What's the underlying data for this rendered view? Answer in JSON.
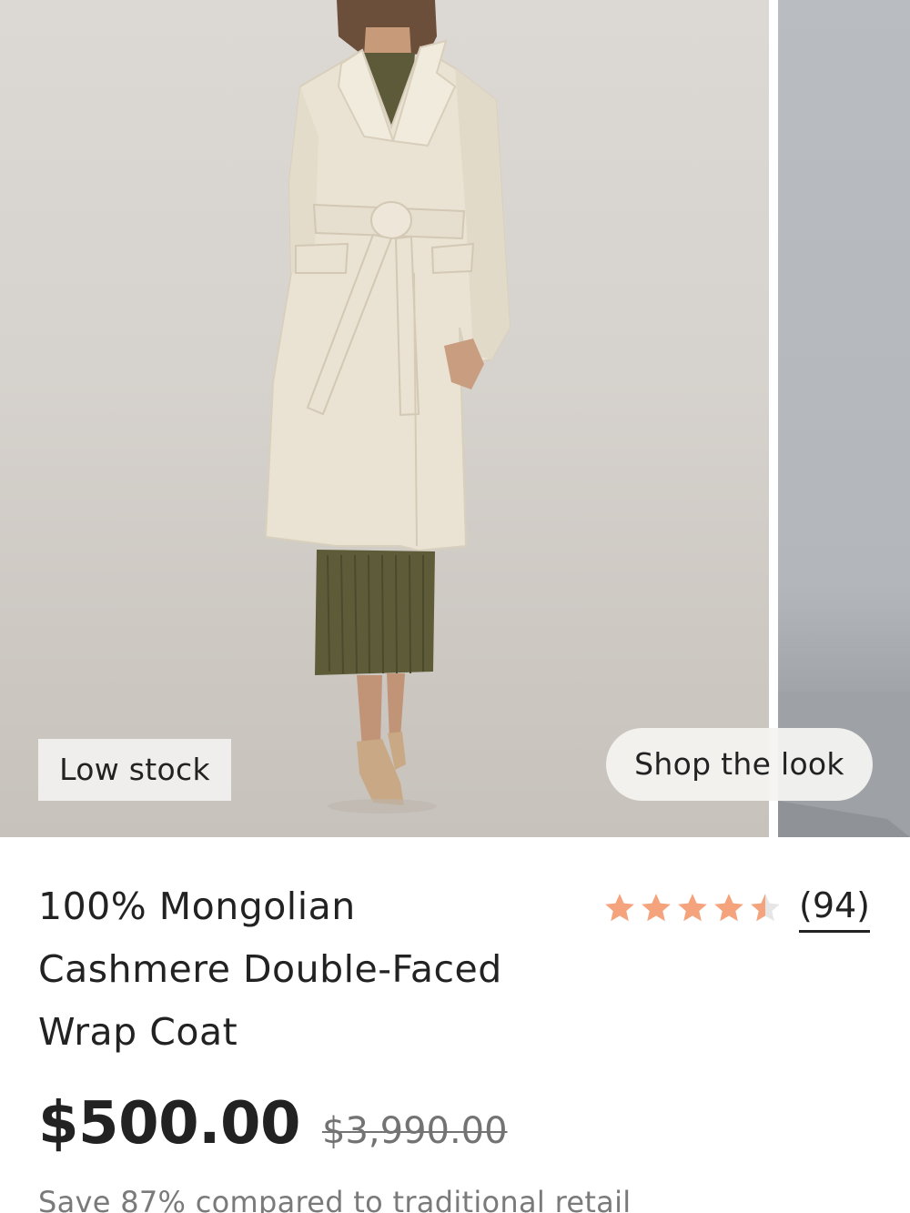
{
  "gallery": {
    "main_image_alt": "",
    "badge": "Low stock",
    "shop_the_look": "Shop the look"
  },
  "product": {
    "title_line_1": "100% Mongolian",
    "title_line_2": "Cashmere Double-Faced",
    "title_line_3": "Wrap Coat",
    "rating": {
      "stars": 4.5,
      "max_stars": 5,
      "review_count": "(94)",
      "star_color": "#f4a37c",
      "star_empty_color": "#e6e6e6"
    },
    "price": "$500.00",
    "original_price": "$3,990.00",
    "savings_text": "Save 87% compared to traditional retail"
  },
  "colors": {
    "text": "#222222",
    "muted": "#737373",
    "badge_bg": "#efeeec"
  }
}
